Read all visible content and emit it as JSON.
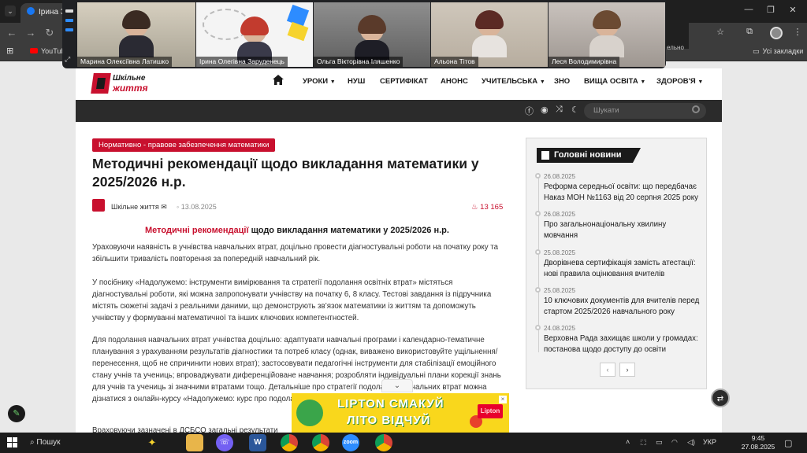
{
  "browser": {
    "tab_title": "Ірина За",
    "bookmark_youtube": "YouTub",
    "bookmarks_all": "Усі закладки",
    "popup_fragment": "ельно"
  },
  "call": {
    "participants": [
      {
        "name": "Марина Олексіївна Латишко"
      },
      {
        "name": "Ірина Олегівна Заруденець"
      },
      {
        "name": "Ольга Вікторівна Іляшенко"
      },
      {
        "name": "Альона Тітов"
      },
      {
        "name": "Леся Володимирівна"
      }
    ],
    "colors": {
      "active_speaker": "#23d18b",
      "app_accent": "#2d8cff"
    }
  },
  "site": {
    "logo_line1": "Шкільне",
    "logo_line2": "життя",
    "brand_color": "#c8102e",
    "menu": [
      "УРОКИ",
      "НУШ",
      "СЕРТИФІКАТ",
      "АНОНС",
      "УЧИТЕЛЬСЬКА",
      "ЗНО",
      "ВИЩА ОСВІТА",
      "ЗДОРОВ'Я"
    ],
    "search_placeholder": "Шукати"
  },
  "article": {
    "category": "Нормативно - правове забезпечення математики",
    "title": "Методичні рекомендації щодо викладання математики у 2025/2026 н.р.",
    "author": "Шкільне життя",
    "date": "13.08.2025",
    "views": "13 165",
    "subtitle_red": "Методичні рекомендації",
    "subtitle_rest": " щодо викладання математики у 2025/2026 н.р.",
    "paragraphs": [
      "Ураховуючи наявність в учнівства навчальних втрат, доцільно провести діагностувальні роботи на початку року та збільшити тривалість повторення за попередній навчальний рік.",
      "У посібнику «Надолужемо: інструменти вимірювання та стратегії подолання освітніх втрат» містяться діагностувальні роботи, які можна запропонувати учнівству на початку 6, 8 класу. Тестові завдання із підручника містять сюжетні задачі з реальними даними, що демонструють зв’язок математики із життям та допоможуть учнівству у формуванні математичної та інших ключових компетентностей.",
      "Для подолання навчальних втрат учнівства доцільно: адаптувати навчальні програми і календарно-тематичне планування з урахуванням результатів діагностики та потреб класу (однак, виважено використовуйте ущільнення/перенесення, щоб не спричинити нових втрат); застосовувати педагогічні інструменти для стабілізації емоційного стану учнів та учениць; впроваджувати диференційоване навчання; розробляти індивідуальні плани корекції знань для учнів та учениць зі значними втратами тощо. Детальніше про стратегії подолання навчальних втрат можна дізнатися з онлайн-курсу «Надолужемо: курс про подолання освітніх втрат».",
      "Враховуючи зазначені в ДСБСО загальні результати"
    ]
  },
  "sidebar": {
    "heading": "Головні новини",
    "news": [
      {
        "date": "26.08.2025",
        "title": "Реформа середньої освіти: що передбачає Наказ МОН №1163 від 20 серпня 2025 року"
      },
      {
        "date": "26.08.2025",
        "title": "Про загальнонаціональну хвилину мовчання"
      },
      {
        "date": "25.08.2025",
        "title": "Дворівнева сертифікація замість атестації: нові правила оцінювання вчителів"
      },
      {
        "date": "25.08.2025",
        "title": "10 ключових документів для вчителів перед стартом 2025/2026 навчального року"
      },
      {
        "date": "24.08.2025",
        "title": "Верховна Рада захищає школи у громадах: постанова щодо доступу до освіти"
      }
    ],
    "prev": "‹",
    "next": "›"
  },
  "ad": {
    "line1": "LIPTON СМАКУЙ",
    "line2": "ЛІТО ВІДЧУЙ",
    "brand": "Lipton",
    "close": "×"
  },
  "taskbar": {
    "search": "Пошук",
    "language": "УКР",
    "time": "9:45",
    "date": "27.08.2025",
    "apps": [
      {
        "icon": "W",
        "color": "#2b579a"
      },
      {
        "icon": "zoom",
        "color": "#2d8cff"
      }
    ]
  }
}
